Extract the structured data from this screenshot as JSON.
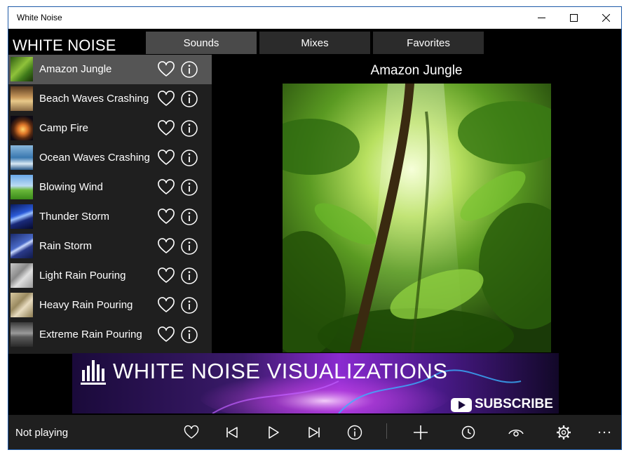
{
  "window": {
    "title": "White Noise"
  },
  "app": {
    "title": "WHITE NOISE"
  },
  "tabs": [
    {
      "label": "Sounds",
      "active": true
    },
    {
      "label": "Mixes",
      "active": false
    },
    {
      "label": "Favorites",
      "active": false
    }
  ],
  "sounds": [
    {
      "name": "Amazon Jungle",
      "selected": true
    },
    {
      "name": "Beach Waves Crashing",
      "selected": false
    },
    {
      "name": "Camp Fire",
      "selected": false
    },
    {
      "name": "Ocean Waves Crashing",
      "selected": false
    },
    {
      "name": "Blowing Wind",
      "selected": false
    },
    {
      "name": "Thunder Storm",
      "selected": false
    },
    {
      "name": "Rain Storm",
      "selected": false
    },
    {
      "name": "Light Rain Pouring",
      "selected": false
    },
    {
      "name": "Heavy Rain Pouring",
      "selected": false
    },
    {
      "name": "Extreme Rain Pouring",
      "selected": false
    }
  ],
  "detail": {
    "title": "Amazon Jungle"
  },
  "banner": {
    "title": "WHITE NOISE VISUALIZATIONS",
    "subscribe": "SUBSCRIBE"
  },
  "player": {
    "status": "Not playing"
  },
  "colors": {
    "background": "#000000",
    "panel": "#1f1f1f",
    "selected": "#555555",
    "tab": "#2b2b2b",
    "tab_active": "#4a4a4a"
  },
  "icons": {
    "favorite": "heart-icon",
    "info": "info-icon",
    "previous": "skip-previous-icon",
    "play": "play-icon",
    "next": "skip-next-icon",
    "add": "plus-icon",
    "timer": "clock-icon",
    "view": "eye-icon",
    "settings": "gear-icon",
    "more": "more-icon"
  }
}
